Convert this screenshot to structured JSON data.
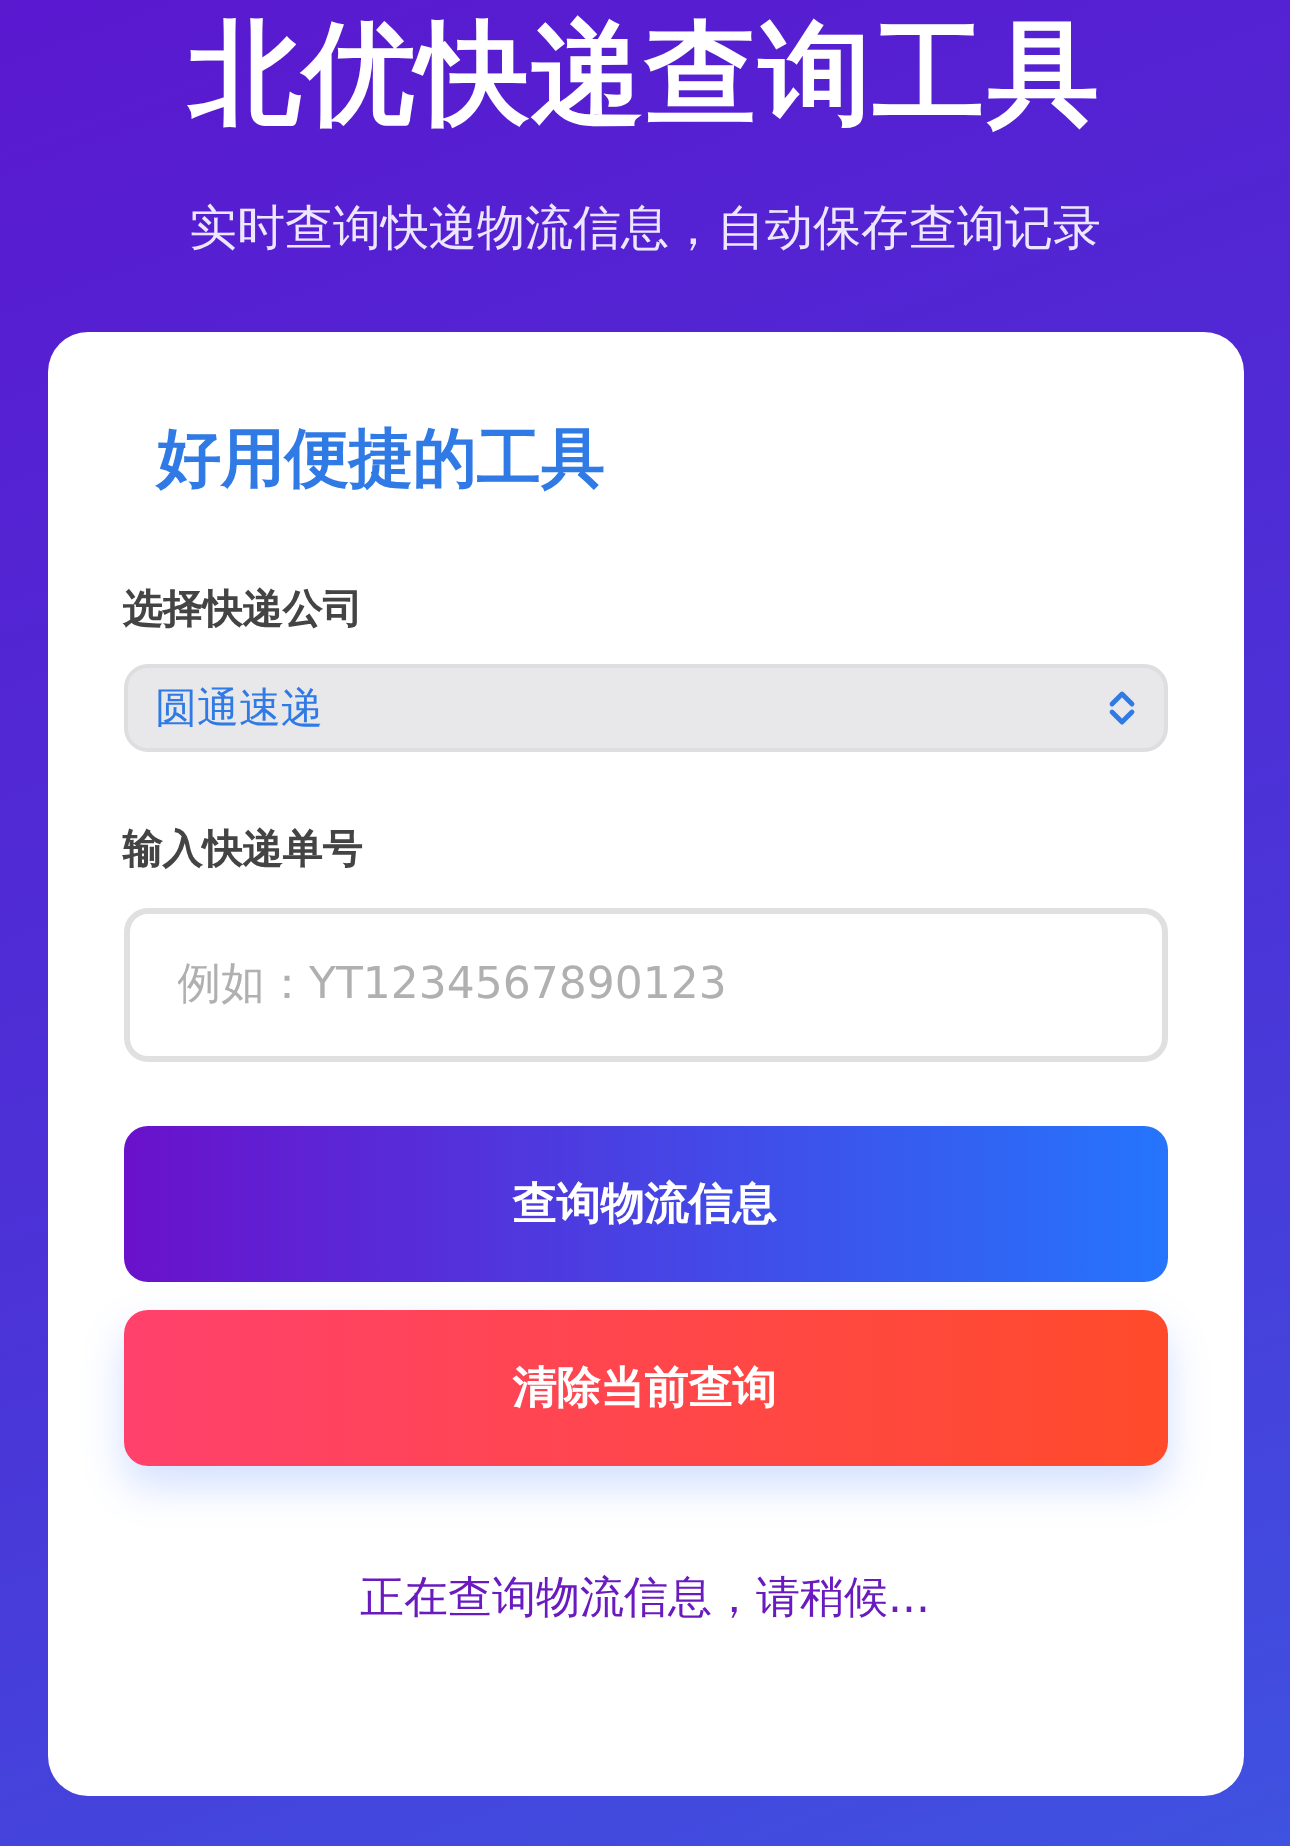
{
  "header": {
    "title": "北优快递查询工具",
    "subtitle": "实时查询快递物流信息，自动保存查询记录"
  },
  "card": {
    "title": "好用便捷的工具",
    "company": {
      "label": "选择快递公司",
      "value": "圆通速递"
    },
    "tracking": {
      "label": "输入快递单号",
      "placeholder": "例如：YT1234567890123"
    },
    "buttons": [
      {
        "label": "查询物流信息",
        "kind": "primary"
      },
      {
        "label": "清除当前查询",
        "kind": "danger"
      }
    ],
    "status": "正在查询物流信息，请稍候..."
  }
}
